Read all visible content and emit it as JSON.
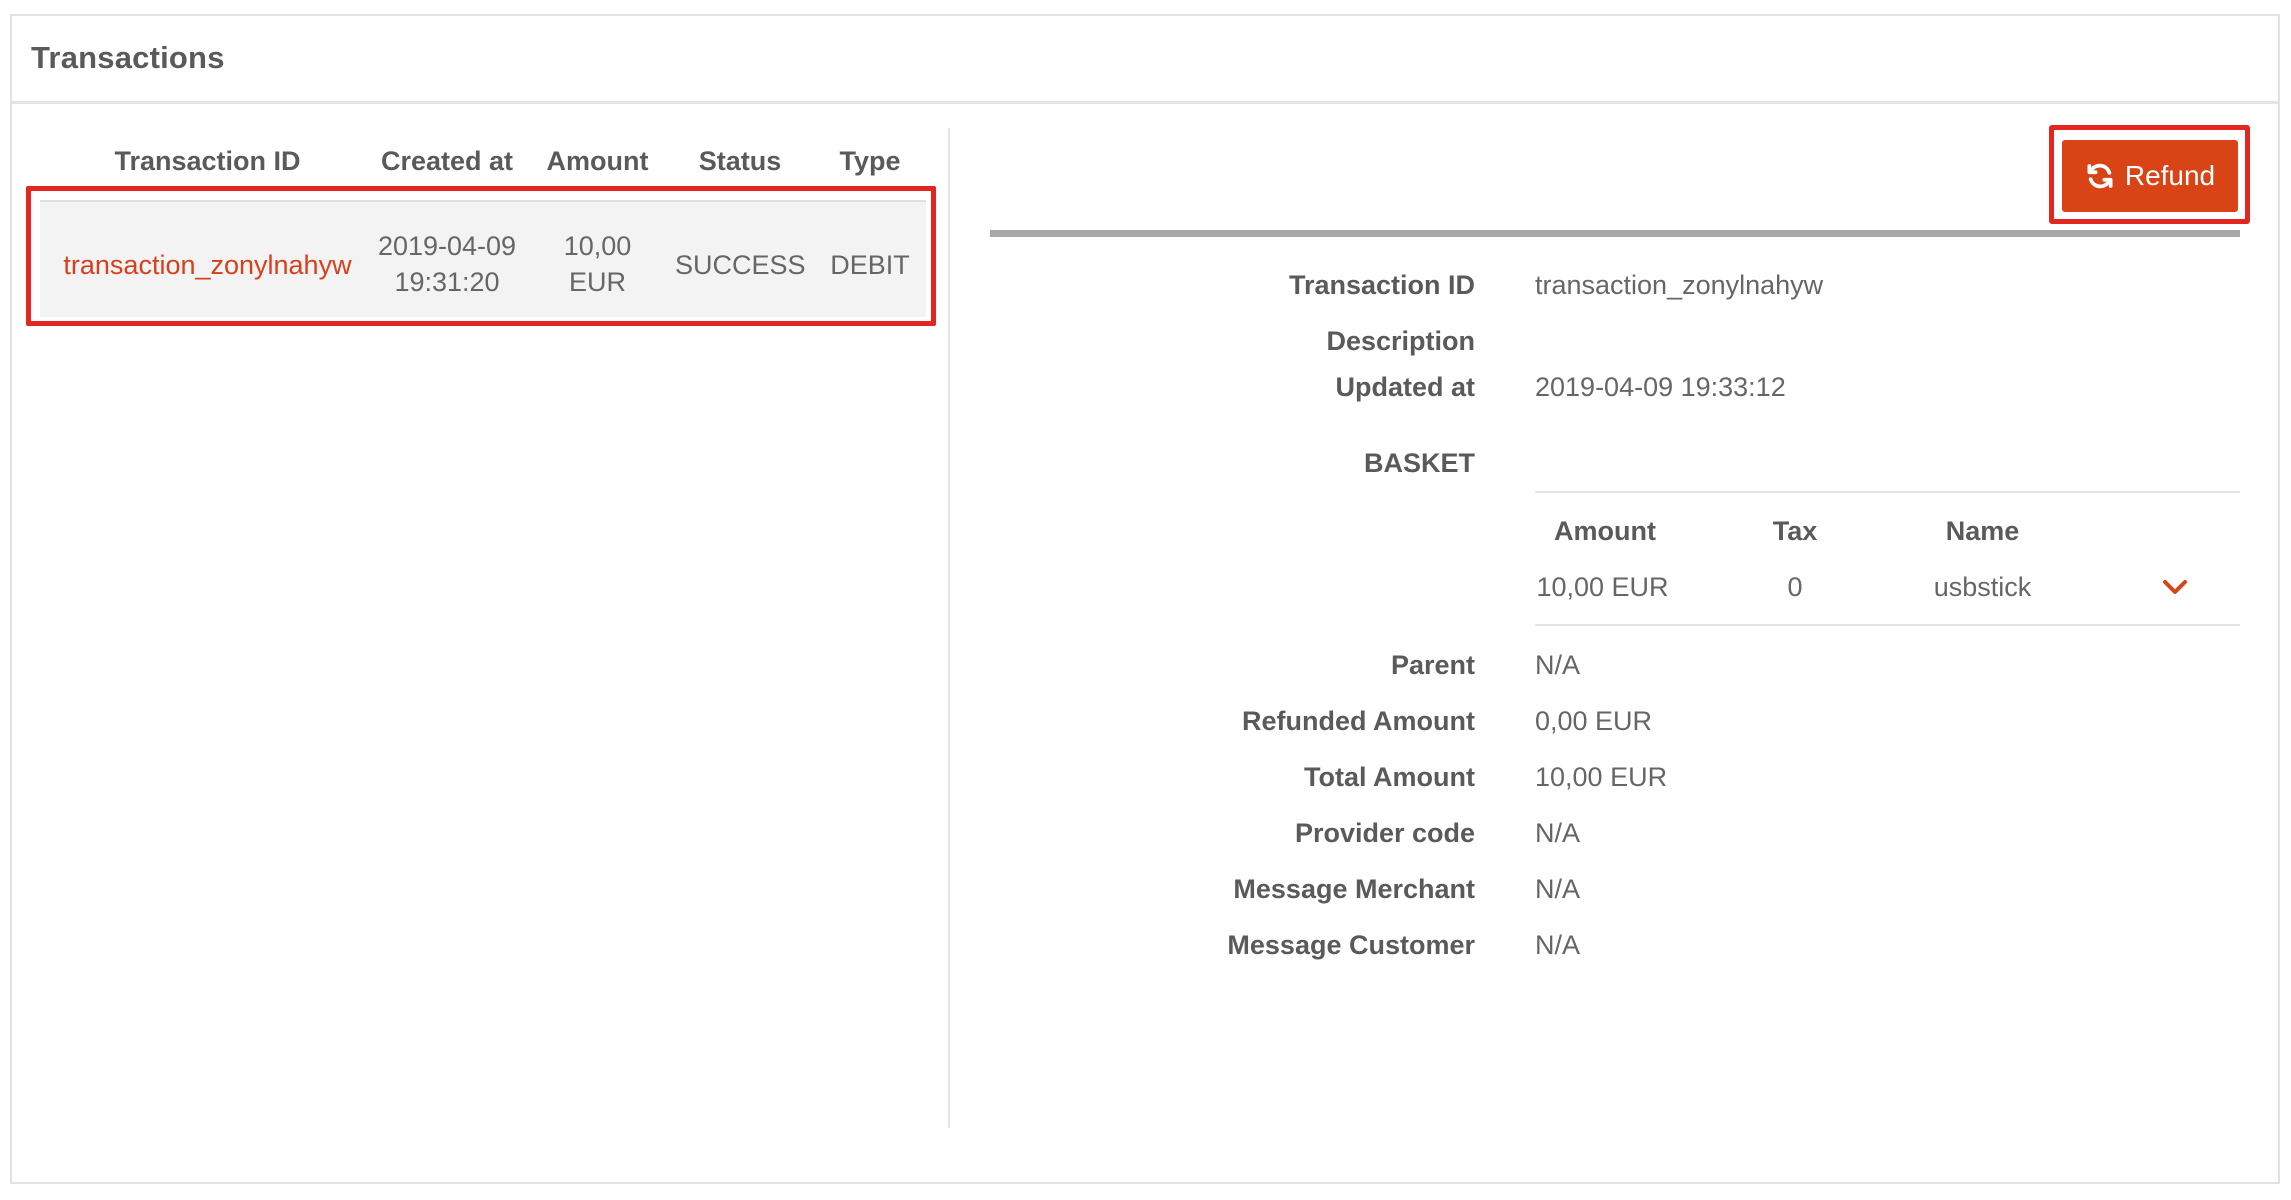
{
  "header": {
    "title": "Transactions"
  },
  "table": {
    "columns": [
      "Transaction ID",
      "Created at",
      "Amount",
      "Status",
      "Type"
    ],
    "rows": [
      {
        "transaction_id": "transaction_zonylnahyw",
        "created_date": "2019-04-09",
        "created_time": "19:31:20",
        "amount_value": "10,00",
        "amount_currency": "EUR",
        "status": "SUCCESS",
        "type": "DEBIT"
      }
    ]
  },
  "actions": {
    "refund_label": "Refund",
    "refund_icon": "refresh-icon"
  },
  "details": {
    "transaction_id_label": "Transaction ID",
    "transaction_id_value": "transaction_zonylnahyw",
    "description_label": "Description",
    "updated_at_label": "Updated at",
    "updated_at_value": "2019-04-09 19:33:12",
    "basket_label": "BASKET",
    "basket": {
      "columns": [
        "Amount",
        "Tax",
        "Name"
      ],
      "items": [
        {
          "amount": "10,00 EUR",
          "tax": "0",
          "name": "usbstick"
        }
      ]
    },
    "parent_label": "Parent",
    "parent_value": "N/A",
    "refunded_amount_label": "Refunded Amount",
    "refunded_amount_value": "0,00 EUR",
    "total_amount_label": "Total Amount",
    "total_amount_value": "10,00 EUR",
    "provider_code_label": "Provider code",
    "provider_code_value": "N/A",
    "message_merchant_label": "Message Merchant",
    "message_merchant_value": "N/A",
    "message_customer_label": "Message Customer",
    "message_customer_value": "N/A"
  },
  "colors": {
    "accent": "#d84416",
    "highlight": "#e3261f",
    "link": "#d6401d"
  }
}
